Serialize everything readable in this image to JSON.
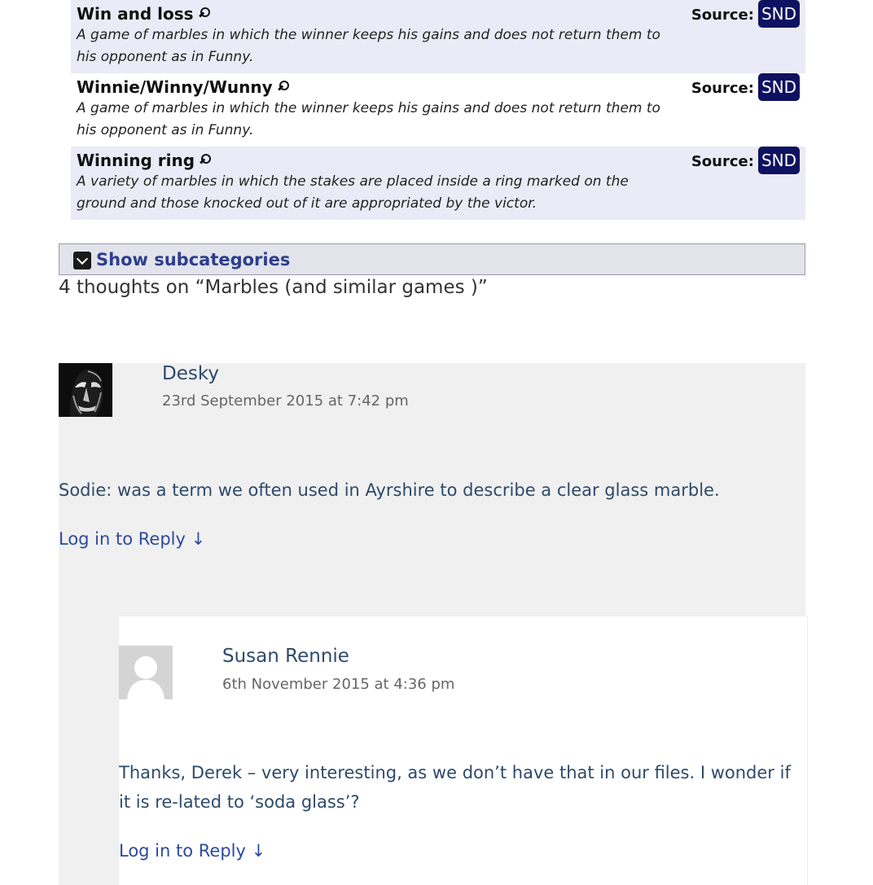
{
  "entries": [
    {
      "title": "Win and loss",
      "definition": "A game of marbles in which the winner keeps his gains and does not return them to his opponent as in Funny.",
      "source_label": "Source:",
      "source": "SND"
    },
    {
      "title": "Winnie/Winny/Wunny",
      "definition": "A game of marbles in which the winner keeps his gains and does not return them to his opponent as in Funny.",
      "source_label": "Source:",
      "source": "SND"
    },
    {
      "title": "Winning ring",
      "definition": "A variety of marbles in which the stakes are placed inside a ring marked on the ground and those knocked out of it are appropriated by the victor.",
      "source_label": "Source:",
      "source": "SND"
    }
  ],
  "subcategories": {
    "label": "Show subcategories"
  },
  "comments_title": "4 thoughts on “Marbles (and similar games )”",
  "comments": [
    {
      "author": "Desky",
      "date": "23rd September 2015 at 7:42 pm",
      "body": "Sodie: was a term we often used in Ayrshire to describe a clear glass marble.",
      "reply": "Log in to Reply ↓"
    },
    {
      "author": "Susan Rennie",
      "date": "6th November 2015 at 4:36 pm",
      "body": "Thanks, Derek – very interesting, as we don’t have that in our files. I wonder if it is re-lated to ‘soda glass’?",
      "reply": "Log in to Reply ↓"
    }
  ],
  "colors": {
    "entry_shade": "#ebebf7",
    "source_badge": "#0f1260",
    "link": "#2c4aa0",
    "comment_bg": "#f0f0f0"
  },
  "icons": {
    "entry_search": "magnifier-icon",
    "subcategories_toggle": "chevron-down-icon",
    "avatar_default": "default-user-icon"
  }
}
